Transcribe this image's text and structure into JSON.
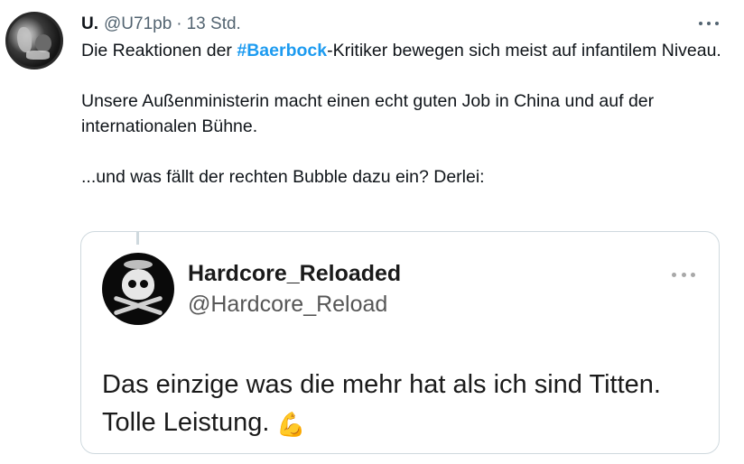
{
  "tweet": {
    "author_name": "U.",
    "author_handle": "@U71pb",
    "separator": "·",
    "timestamp": "13 Std.",
    "text_line1_before": "Die Reaktionen der ",
    "hashtag": "#Baerbock",
    "text_line1_after": "-Kritiker bewegen sich meist auf infantilem Niveau.",
    "text_paragraph2": "Unsere Außenministerin macht einen echt guten Job in China und auf der internationalen Bühne.",
    "text_paragraph3": "...und was fällt der rechten Bubble dazu ein? Derlei:"
  },
  "quoted": {
    "name": "Hardcore_Reloaded",
    "handle": "@Hardcore_Reload",
    "text_line1": "Das einzige was die mehr hat als ich sind Titten.",
    "text_line2": "Tolle Leistung.",
    "emoji": "💪"
  },
  "icons": {
    "more": "more-horizontal-icon",
    "emoji": "flexed-biceps-icon"
  },
  "colors": {
    "hashtag": "#1d9bf0",
    "secondary_text": "#536471",
    "border": "#cfd9de"
  }
}
